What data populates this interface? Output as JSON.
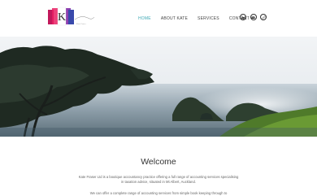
{
  "header": {
    "logo_letter": "K",
    "logo_tagline": "Kate Fraser",
    "nav": [
      {
        "label": "HOME",
        "active": true
      },
      {
        "label": "ABOUT KATE",
        "active": false
      },
      {
        "label": "SERVICES",
        "active": false
      },
      {
        "label": "CONTACT",
        "active": false
      }
    ],
    "social_icons": [
      "linkedin-icon",
      "email-icon",
      "link-icon"
    ],
    "accent_color": "#3fa9b5"
  },
  "hero": {
    "image": "coastal-landscape-with-pohutukawa-tree-and-islands"
  },
  "main": {
    "heading": "Welcome",
    "paragraph_1": "Kate Fraser Ltd is a boutique accountancy practice offering a full range of accounting services specialising in taxation advice, situated in Mt Albert, Auckland.",
    "paragraph_2": "We can offer a complete range of accounting services from simple book keeping through to"
  }
}
